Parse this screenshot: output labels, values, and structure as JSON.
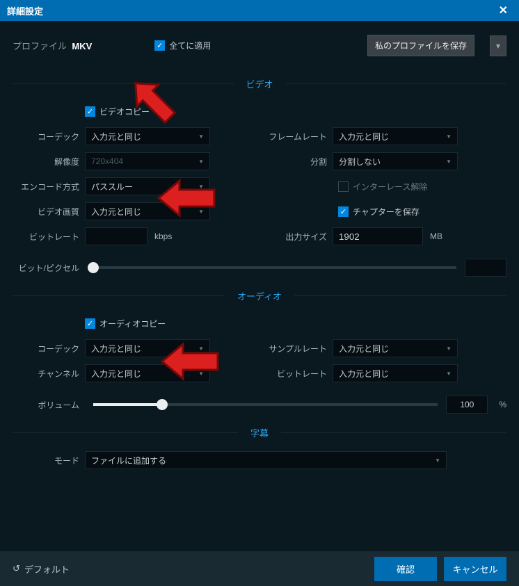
{
  "titlebar": {
    "title": "詳細設定"
  },
  "profile": {
    "label": "プロファイル",
    "name": "MKV"
  },
  "apply_all": {
    "label": "全てに適用",
    "checked": true
  },
  "save_profile": {
    "label": "私のプロファイルを保存"
  },
  "sections": {
    "video": {
      "title": "ビデオ"
    },
    "audio": {
      "title": "オーディオ"
    },
    "subtitle": {
      "title": "字幕"
    }
  },
  "video": {
    "copy": {
      "label": "ビデオコピー",
      "checked": true
    },
    "codec": {
      "label": "コーデック",
      "value": "入力元と同じ"
    },
    "resolution": {
      "label": "解像度",
      "value": "720x404"
    },
    "encode": {
      "label": "エンコード方式",
      "value": "パススルー"
    },
    "quality": {
      "label": "ビデオ画質",
      "value": "入力元と同じ"
    },
    "bitrate": {
      "label": "ビットレート",
      "value": "",
      "unit": "kbps"
    },
    "framerate": {
      "label": "フレームレート",
      "value": "入力元と同じ"
    },
    "split": {
      "label": "分割",
      "value": "分割しない"
    },
    "deinterlace": {
      "label": "インターレース解除",
      "checked": false
    },
    "chapter": {
      "label": "チャプターを保存",
      "checked": true
    },
    "output_size": {
      "label": "出力サイズ",
      "value": "1902",
      "unit": "MB"
    },
    "bpp": {
      "label": "ビット/ピクセル",
      "value": ""
    }
  },
  "audio": {
    "copy": {
      "label": "オーディオコピー",
      "checked": true
    },
    "codec": {
      "label": "コーデック",
      "value": "入力元と同じ"
    },
    "channel": {
      "label": "チャンネル",
      "value": "入力元と同じ"
    },
    "samplerate": {
      "label": "サンプルレート",
      "value": "入力元と同じ"
    },
    "bitrate": {
      "label": "ビットレート",
      "value": "入力元と同じ"
    },
    "volume": {
      "label": "ボリューム",
      "value": "100",
      "unit": "%",
      "percent": 20
    }
  },
  "subtitle": {
    "mode": {
      "label": "モード",
      "value": "ファイルに追加する"
    }
  },
  "footer": {
    "default": "デフォルト",
    "ok": "確認",
    "cancel": "キャンセル"
  }
}
